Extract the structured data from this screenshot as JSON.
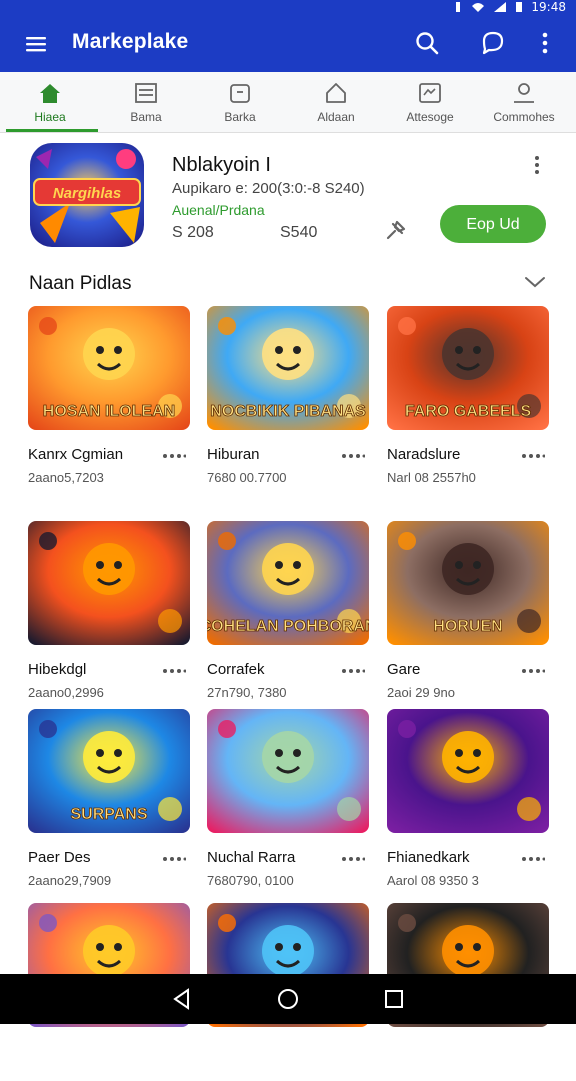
{
  "status": {
    "time": "19:48"
  },
  "appbar": {
    "title": "Markeplake"
  },
  "tabs": [
    {
      "label": "Hiaea",
      "icon": "home-icon"
    },
    {
      "label": "Bama",
      "icon": "list-icon"
    },
    {
      "label": "Barka",
      "icon": "bag-icon"
    },
    {
      "label": "Aldaan",
      "icon": "house-outline-icon"
    },
    {
      "label": "Attesoge",
      "icon": "message-icon"
    },
    {
      "label": "Commohes",
      "icon": "person-icon"
    }
  ],
  "featured": {
    "title": "Nblakyoin I",
    "subtitle": "Aupikaro e: 200(3:0:-8 S240)",
    "developer": "Auenal/Prdana",
    "num1": "S 208",
    "num2": "S540",
    "button": "Eop Ud",
    "image_text": "Nargihlas"
  },
  "section": {
    "title": "Naan Pidlas"
  },
  "games": [
    {
      "title": "Kanrx Cgmian",
      "sub": "2aano5,7203",
      "art": "HOSAN ILOLEAN"
    },
    {
      "title": "Hiburan",
      "sub": "7680 00.7700",
      "art": "NOCBIKIK PIBANAS"
    },
    {
      "title": "Naradslure",
      "sub": "Narl 08 2557h0",
      "art": "FARO GABEELS"
    },
    {
      "title": "Hibekdgl",
      "sub": "2aano0,2996",
      "art": ""
    },
    {
      "title": "Corrafek",
      "sub": "27n790, 7380",
      "art": "COHELAN POHBORAN"
    },
    {
      "title": "Gare",
      "sub": "2aoi 29 9no",
      "art": "HORUEN"
    },
    {
      "title": "Paer Des",
      "sub": "2aano29,7909",
      "art": "SURPANS"
    },
    {
      "title": "Nuchal Rarra",
      "sub": "7680790, 0100",
      "art": ""
    },
    {
      "title": "Fhianedkark",
      "sub": "Aarol 08 9350 3",
      "art": ""
    },
    {
      "title": "",
      "sub": "",
      "art": ""
    },
    {
      "title": "",
      "sub": "",
      "art": ""
    },
    {
      "title": "",
      "sub": "",
      "art": ""
    }
  ]
}
